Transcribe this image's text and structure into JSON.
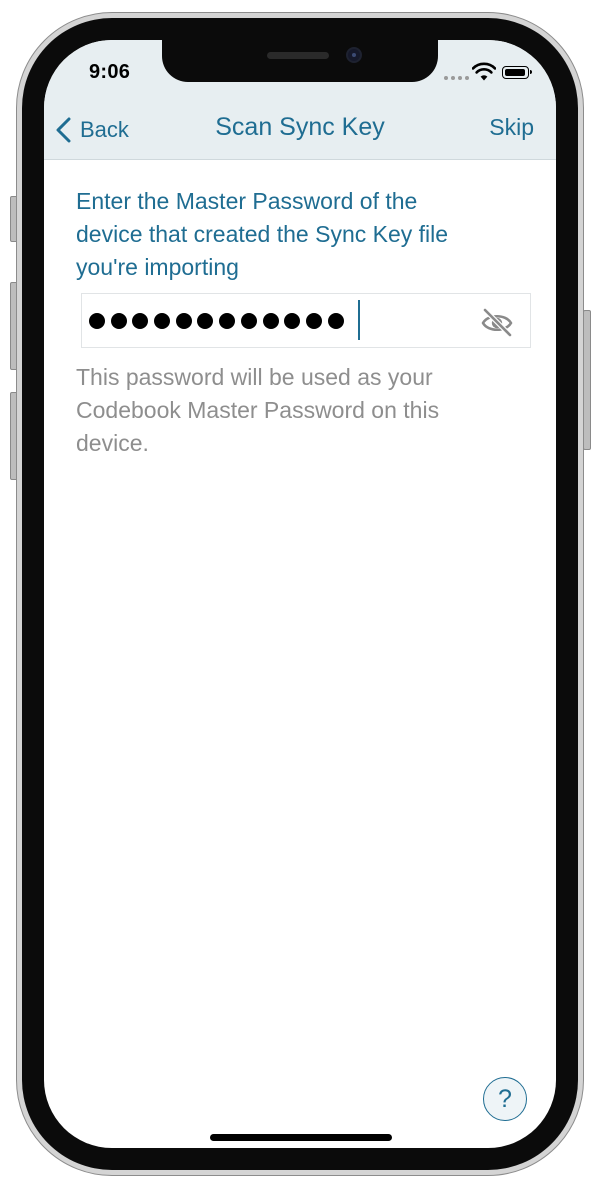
{
  "status_bar": {
    "time": "9:06",
    "icons": [
      "cellular-dots-icon",
      "wifi-icon",
      "battery-icon"
    ]
  },
  "nav": {
    "back_label": "Back",
    "title": "Scan Sync Key",
    "skip_label": "Skip"
  },
  "form": {
    "prompt_line1": "Enter the Master Password of the",
    "prompt_line2": "device that created the Sync Key file",
    "prompt_line3": "you're importing",
    "password_value": "••••••••••••",
    "password_length": 12,
    "toggle_icon": "eye-slash-icon",
    "helper_line1": "This password will be used as your",
    "helper_line2": "Codebook Master Password on this",
    "helper_line3": "device."
  },
  "help": {
    "label": "?"
  },
  "colors": {
    "accent": "#1f6d92",
    "header_bg": "#e7eef1",
    "helper_text": "#8e8e8e",
    "frame": "#0b0b0b"
  }
}
